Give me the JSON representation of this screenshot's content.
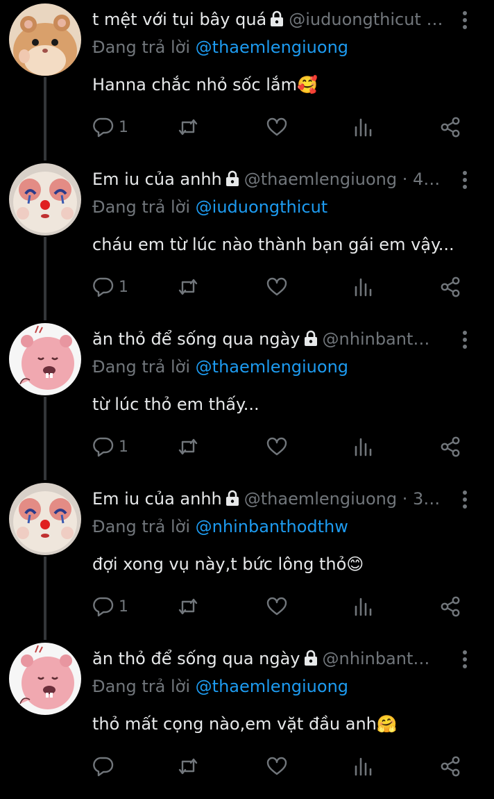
{
  "tweets": [
    {
      "display_name": "t mệt với tụi bây quá",
      "handle": "@iuduongthicut …",
      "replying_prefix": "Đang trả lời",
      "replying_to": "@thaemlengiuong",
      "text": "Hanna chắc nhỏ sốc lắm🥰",
      "reply_count": "1",
      "avatar": "hamster-icon"
    },
    {
      "display_name": "Em iu của anhh",
      "handle": "@thaemlengiuong · 4…",
      "replying_prefix": "Đang trả lời",
      "replying_to": "@iuduongthicut",
      "text": "cháu em từ lúc nào thành bạn gái em vậy...",
      "reply_count": "1",
      "avatar": "clown-cat-icon"
    },
    {
      "display_name": "ăn thỏ để sống qua ngày",
      "handle": "@nhinbant…",
      "replying_prefix": "Đang trả lời",
      "replying_to": "@thaemlengiuong",
      "text": "từ lúc thỏ em thấy...",
      "reply_count": "1",
      "avatar": "pink-beaver-icon"
    },
    {
      "display_name": "Em iu của anhh",
      "handle": "@thaemlengiuong · 3…",
      "replying_prefix": "Đang trả lời",
      "replying_to": "@nhinbanthodthw",
      "text": "đợi xong vụ này,t bức lông thỏ😊",
      "reply_count": "1",
      "avatar": "clown-cat-icon"
    },
    {
      "display_name": "ăn thỏ để sống qua ngày",
      "handle": "@nhinbant…",
      "replying_prefix": "Đang trả lời",
      "replying_to": "@thaemlengiuong",
      "text": "thỏ mất cọng nào,em vặt đầu anh🤗",
      "reply_count": "",
      "avatar": "pink-beaver-icon"
    }
  ],
  "colors": {
    "background": "#000000",
    "text": "#e7e9ea",
    "muted": "#71767b",
    "link": "#1d9bf0",
    "thread_line": "#333639"
  }
}
